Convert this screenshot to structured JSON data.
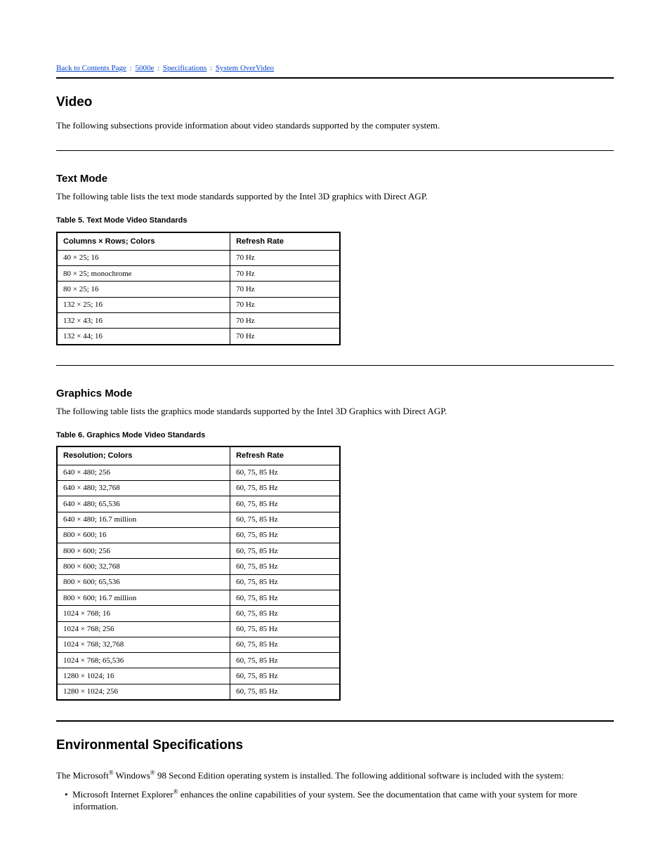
{
  "breadcrumbs": {
    "back": "Back to Contents Page",
    "sep": " : ",
    "model": "5000e",
    "sep2": " : ",
    "section": "Specifications",
    "sep3": " : ",
    "subsection": "System OverVideo"
  },
  "title": "Video",
  "intro": "The following subsections provide information about video standards supported by the computer system.",
  "subsection1": {
    "heading": "Text Mode",
    "text": "The following table lists the text mode standards supported by the Intel 3D graphics with Direct AGP.",
    "caption": "Table 5. Text Mode Video Standards",
    "headers": [
      "Columns × Rows; Colors",
      "Refresh Rate"
    ],
    "rows": [
      [
        "40 × 25; 16",
        "70 Hz"
      ],
      [
        "80 × 25; monochrome",
        "70 Hz"
      ],
      [
        "80 × 25; 16",
        "70 Hz"
      ],
      [
        "132 × 25; 16",
        "70 Hz"
      ],
      [
        "132 × 43; 16",
        "70 Hz"
      ],
      [
        "132 × 44; 16",
        "70 Hz"
      ]
    ]
  },
  "subsection2": {
    "heading": "Graphics Mode",
    "text": "The following table lists the graphics mode standards supported by the Intel 3D Graphics with Direct AGP.",
    "caption": "Table 6. Graphics Mode Video Standards",
    "headers": [
      "Resolution; Colors",
      "Refresh Rate"
    ],
    "rows": [
      [
        "640 × 480; 256",
        "60, 75, 85 Hz"
      ],
      [
        "640 × 480; 32,768",
        "60, 75, 85 Hz"
      ],
      [
        "640 × 480; 65,536",
        "60, 75, 85 Hz"
      ],
      [
        "640 × 480; 16.7 million",
        "60, 75, 85 Hz"
      ],
      [
        "800 × 600; 16",
        "60, 75, 85 Hz"
      ],
      [
        "800 × 600; 256",
        "60, 75, 85 Hz"
      ],
      [
        "800 × 600; 32,768",
        "60, 75, 85 Hz"
      ],
      [
        "800 × 600; 65,536",
        "60, 75, 85 Hz"
      ],
      [
        "800 × 600; 16.7 million",
        "60, 75, 85 Hz"
      ],
      [
        "1024 × 768; 16",
        "60, 75, 85 Hz"
      ],
      [
        "1024 × 768; 256",
        "60, 75, 85 Hz"
      ],
      [
        "1024 × 768; 32,768",
        "60, 75, 85 Hz"
      ],
      [
        "1024 × 768; 65,536",
        "60, 75, 85 Hz"
      ],
      [
        "1280 × 1024; 16",
        "60, 75, 85 Hz"
      ],
      [
        "1280 × 1024; 256",
        "60, 75, 85 Hz"
      ]
    ]
  },
  "footer": {
    "heading": "Environmental Specifications",
    "para1a": "The Microsoft",
    "para1b": " Windows",
    "para1c": " 98 Second Edition operating system is installed. The following additional software is included with the system:",
    "bullet1a": "Microsoft Internet Explorer",
    "bullet1b": " enhances the online capabilities of your system. See the documentation that came with your system for more information."
  }
}
